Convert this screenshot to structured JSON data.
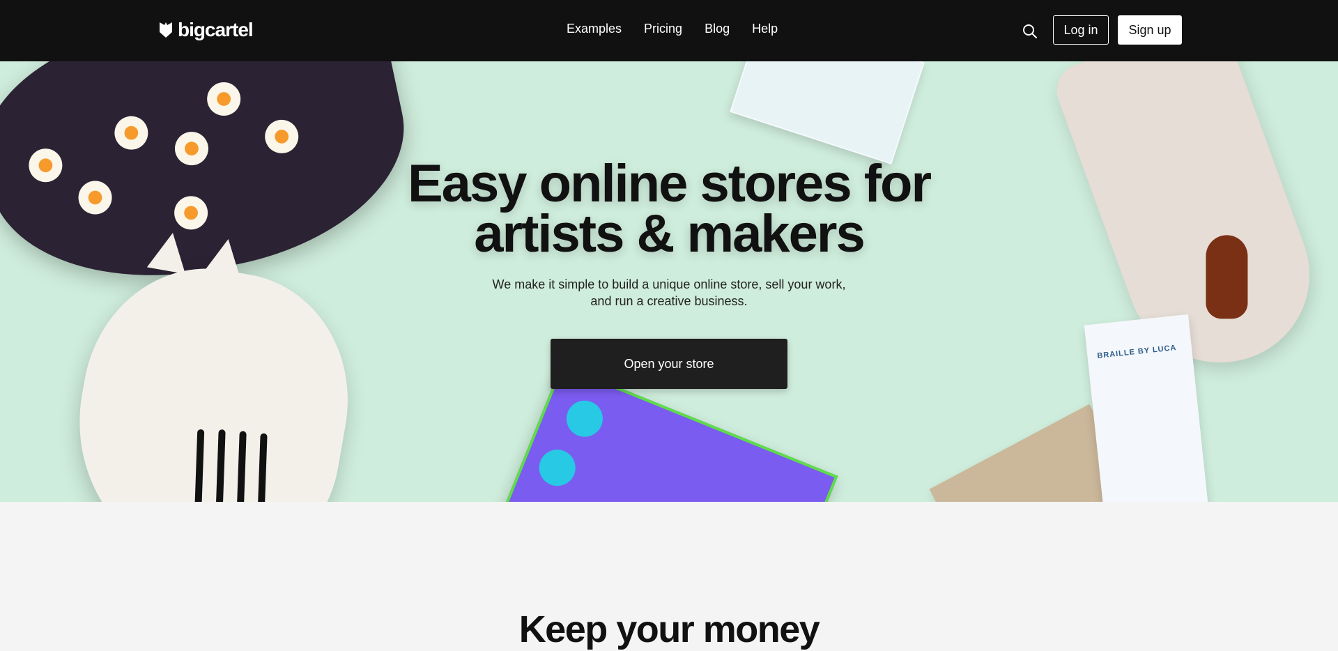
{
  "header": {
    "logo_text": "bigcartel",
    "nav": [
      "Examples",
      "Pricing",
      "Blog",
      "Help"
    ],
    "login_label": "Log in",
    "signup_label": "Sign up"
  },
  "hero": {
    "title_line1": "Easy online stores for",
    "title_line2": "artists & makers",
    "subtitle_line1": "We make it simple to build a unique online store, sell your work,",
    "subtitle_line2": "and run a creative business.",
    "cta_label": "Open your store",
    "braille_card_title": "BRAILLE BY LUCA"
  },
  "section": {
    "title": "Keep your money"
  },
  "colors": {
    "header_bg": "#111111",
    "hero_bg": "#cfeddc",
    "page_bg": "#f4f4f4",
    "cta_bg": "#1f1f1f"
  }
}
